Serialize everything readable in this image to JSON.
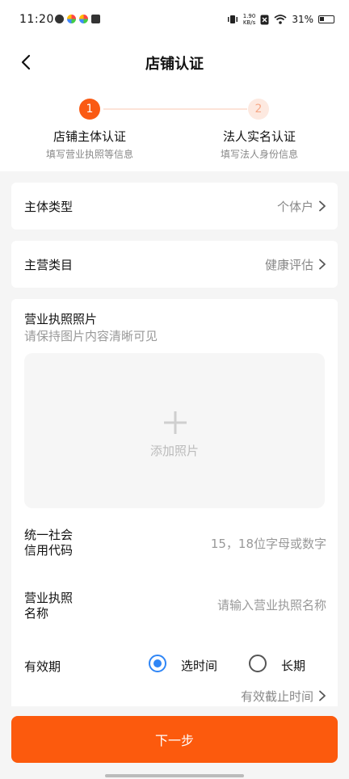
{
  "status_bar": {
    "time": "11:20",
    "net_speed_value": "1.90",
    "net_speed_unit": "KB/s",
    "battery": "31%"
  },
  "header": {
    "title": "店铺认证",
    "back_icon": "chevron-left-icon"
  },
  "steps": [
    {
      "number": "1",
      "title": "店铺主体认证",
      "subtitle": "填写营业执照等信息",
      "active": true
    },
    {
      "number": "2",
      "title": "法人实名认证",
      "subtitle": "填写法人身份信息",
      "active": false
    }
  ],
  "form": {
    "entity_type": {
      "label": "主体类型",
      "value": "个体户"
    },
    "main_category": {
      "label": "主营类目",
      "value": "健康评估"
    },
    "license": {
      "title": "营业执照照片",
      "hint": "请保持图片内容清晰可见",
      "upload_label": "添加照片"
    },
    "credit_code": {
      "label_line1": "统一社会",
      "label_line2": "信用代码",
      "placeholder": "15，18位字母或数字"
    },
    "license_name": {
      "label_line1": "营业执照",
      "label_line2": "名称",
      "placeholder": "请输入营业执照名称"
    },
    "validity": {
      "label": "有效期",
      "options": [
        "选时间",
        "长期"
      ],
      "selected": "选时间",
      "expire_label": "有效截止时间"
    }
  },
  "footer": {
    "next_label": "下一步"
  },
  "colors": {
    "accent": "#fc5a0d",
    "radio_selected": "#2f86f6"
  }
}
